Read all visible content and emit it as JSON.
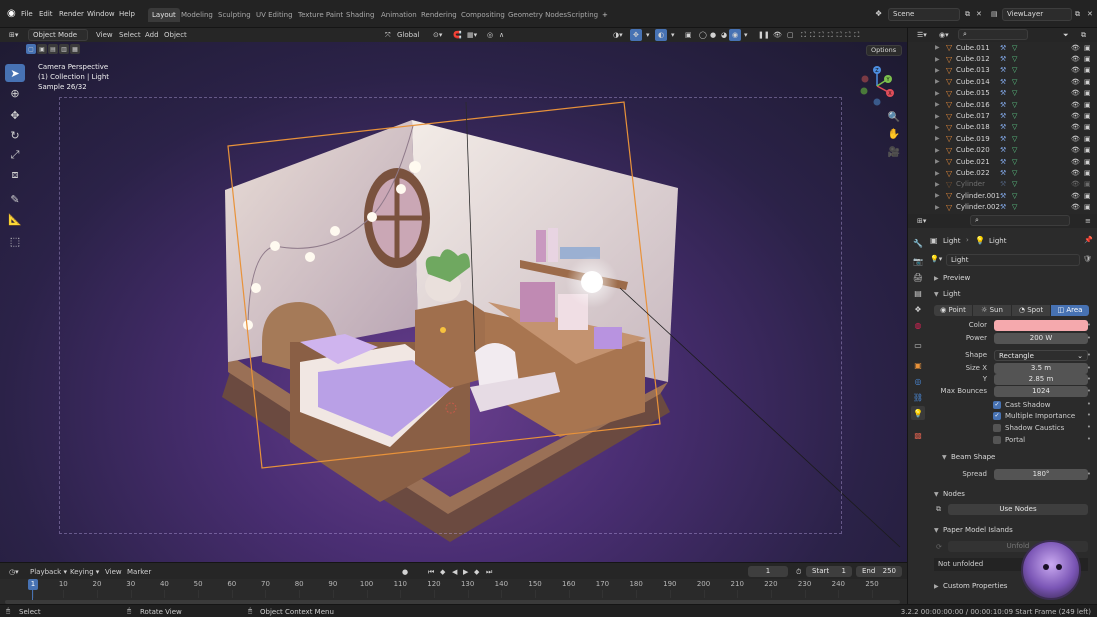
{
  "topbar": {
    "menus": [
      "File",
      "Edit",
      "Render",
      "Window",
      "Help"
    ],
    "workspaces": [
      "Layout",
      "Modeling",
      "Sculpting",
      "UV Editing",
      "Texture Paint",
      "Shading",
      "Animation",
      "Rendering",
      "Compositing",
      "Geometry Nodes",
      "Scripting"
    ],
    "active_workspace": "Layout",
    "add_workspace": "+",
    "scene": "Scene",
    "view_layer": "ViewLayer"
  },
  "viewport_header": {
    "mode": "Object Mode",
    "menus": [
      "View",
      "Select",
      "Add",
      "Object"
    ],
    "transform_orientation": "Global",
    "options_label": "Options"
  },
  "viewport": {
    "overlay_line1": "Camera Perspective",
    "overlay_line2": "(1) Collection | Light",
    "overlay_line3": "Sample 26/32",
    "gizmo_axes": {
      "x": "X",
      "y": "Y",
      "z": "Z"
    }
  },
  "outliner": {
    "rows": [
      {
        "name": "Cube.011",
        "visible": true
      },
      {
        "name": "Cube.012",
        "visible": true
      },
      {
        "name": "Cube.013",
        "visible": true
      },
      {
        "name": "Cube.014",
        "visible": true
      },
      {
        "name": "Cube.015",
        "visible": true
      },
      {
        "name": "Cube.016",
        "visible": true
      },
      {
        "name": "Cube.017",
        "visible": true
      },
      {
        "name": "Cube.018",
        "visible": true
      },
      {
        "name": "Cube.019",
        "visible": true
      },
      {
        "name": "Cube.020",
        "visible": true
      },
      {
        "name": "Cube.021",
        "visible": true
      },
      {
        "name": "Cube.022",
        "visible": true
      },
      {
        "name": "Cylinder",
        "visible": false
      },
      {
        "name": "Cylinder.001",
        "visible": true
      },
      {
        "name": "Cylinder.002",
        "visible": true
      },
      {
        "name": "Cylinder.003",
        "visible": true
      }
    ]
  },
  "properties": {
    "breadcrumb_object": "Light",
    "breadcrumb_data": "Light",
    "data_name": "Light",
    "section_preview": "Preview",
    "section_light": "Light",
    "light_types": [
      "Point",
      "Sun",
      "Spot",
      "Area"
    ],
    "active_light_type": "Area",
    "color_label": "Color",
    "color_value": "#f5a9ad",
    "power_label": "Power",
    "power_value": "200 W",
    "shape_label": "Shape",
    "shape_value": "Rectangle",
    "sizex_label": "Size X",
    "sizex_value": "3.5 m",
    "sizey_label": "Y",
    "sizey_value": "2.85 m",
    "bounces_label": "Max Bounces",
    "bounces_value": "1024",
    "cast_shadow": "Cast Shadow",
    "multiple_importance": "Multiple Importance",
    "shadow_caustics": "Shadow Caustics",
    "portal": "Portal",
    "section_beam": "Beam Shape",
    "spread_label": "Spread",
    "spread_value": "180°",
    "section_nodes": "Nodes",
    "use_nodes": "Use Nodes",
    "section_paper": "Paper Model Islands",
    "unfold_button": "Unfold",
    "not_unfolded": "Not unfolded",
    "section_custom": "Custom Properties"
  },
  "timeline": {
    "menus": [
      "Playback",
      "Keying",
      "View",
      "Marker"
    ],
    "current_frame": "1",
    "start_label": "Start",
    "start_value": "1",
    "end_label": "End",
    "end_value": "250",
    "ticks": [
      "1",
      "10",
      "20",
      "30",
      "40",
      "50",
      "60",
      "70",
      "80",
      "90",
      "100",
      "110",
      "120",
      "130",
      "140",
      "150",
      "160",
      "170",
      "180",
      "190",
      "200",
      "210",
      "220",
      "230",
      "240",
      "250"
    ]
  },
  "statusbar": {
    "select": "Select",
    "rotate_view": "Rotate View",
    "context_menu": "Object Context Menu",
    "info": "3.2.2 00:00:00:00 / 00:00:10:09 Start Frame (249 left)"
  },
  "colors": {
    "accent": "#4772b3",
    "selection_orange": "#e8923a",
    "light_color": "#f5a9ad"
  }
}
